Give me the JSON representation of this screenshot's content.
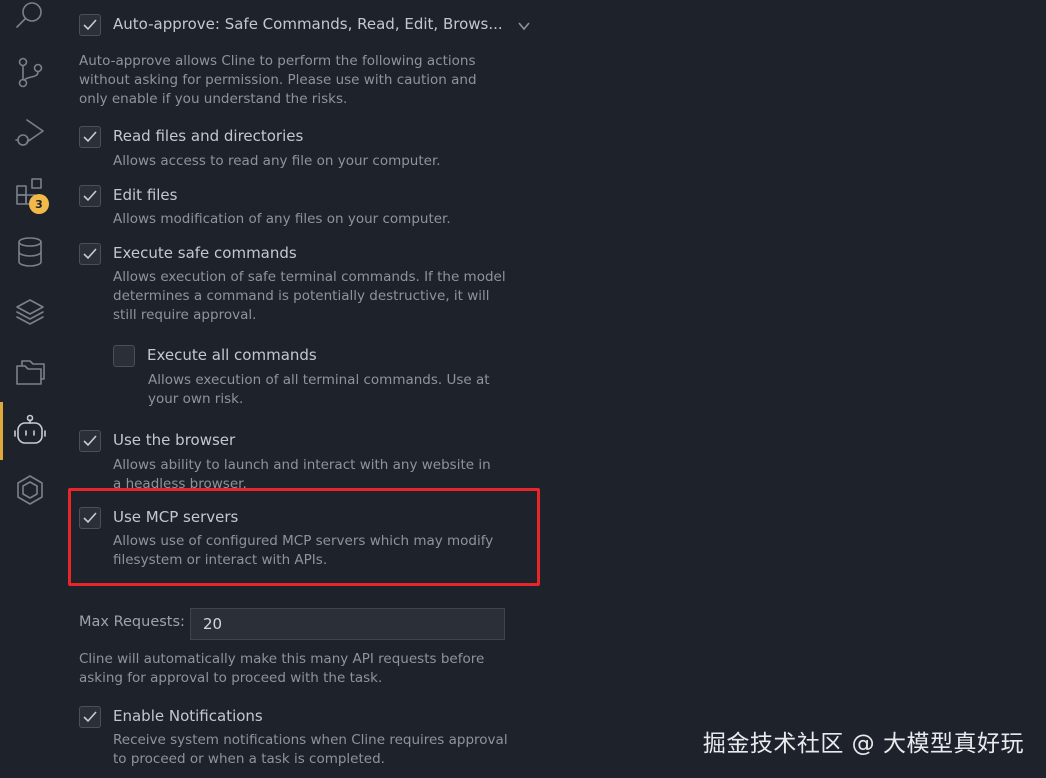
{
  "activity_bar": {
    "extensions_badge": "3"
  },
  "header": {
    "label": "Auto-approve: Safe Commands, Read, Edit, Brows...",
    "description": "Auto-approve allows Cline to perform the following actions without asking for permission. Please use with caution and only enable if you understand the risks."
  },
  "options": [
    {
      "label": "Read files and directories",
      "description": "Allows access to read any file on your computer.",
      "checked": true
    },
    {
      "label": "Edit files",
      "description": "Allows modification of any files on your computer.",
      "checked": true
    },
    {
      "label": "Execute safe commands",
      "description": "Allows execution of safe terminal commands. If the model determines a command is potentially destructive, it will still require approval.",
      "checked": true
    },
    {
      "label": "Execute all commands",
      "description": "Allows execution of all terminal commands. Use at your own risk.",
      "checked": false
    },
    {
      "label": "Use the browser",
      "description": "Allows ability to launch and interact with any website in a headless browser.",
      "checked": true
    },
    {
      "label": "Use MCP servers",
      "description": "Allows use of configured MCP servers which may modify filesystem or interact with APIs.",
      "checked": true
    }
  ],
  "max_requests": {
    "label": "Max Requests:",
    "value": "20",
    "description": "Cline will automatically make this many API requests before asking for approval to proceed with the task."
  },
  "notifications": {
    "label": "Enable Notifications",
    "description": "Receive system notifications when Cline requires approval to proceed or when a task is completed.",
    "checked": true
  },
  "watermark": "掘金技术社区 @ 大模型真好玩",
  "colors": {
    "background": "#1e222b",
    "highlight": "#e8262a",
    "badge": "#f1b94a",
    "active_indicator": "#e0a83a"
  }
}
